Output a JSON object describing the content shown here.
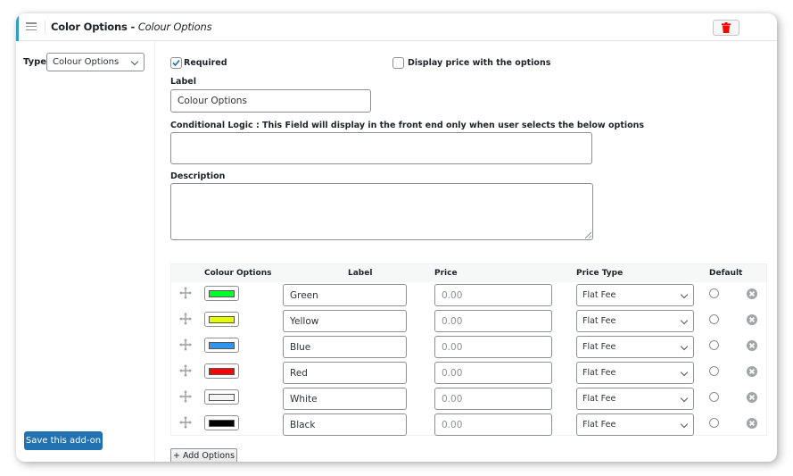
{
  "header": {
    "title_bold": "Color Options - ",
    "title_italic": "Colour Options",
    "menu_icon": "hamburger-menu-icon",
    "delete_icon": "trash-icon"
  },
  "sidebar": {
    "type_label": "Type",
    "type_value": "Colour Options",
    "save_button": "Save this add-on"
  },
  "form": {
    "required_label": "Required",
    "required_checked": true,
    "display_price_label": "Display price with the options",
    "display_price_checked": false,
    "label_heading": "Label",
    "label_value": "Colour Options",
    "conditional_logic_heading": "Conditional Logic : This Field will display in the front end only when user selects the below options",
    "conditional_logic_value": "",
    "description_heading": "Description",
    "description_value": ""
  },
  "options_table": {
    "headers": [
      "Colour Options",
      "Label",
      "Price",
      "Price Type",
      "Default"
    ],
    "rows": [
      {
        "color": "#00ff2a",
        "label": "Green",
        "price_placeholder": "0.00",
        "price_type": "Flat Fee",
        "default": false
      },
      {
        "color": "#e6ff00",
        "label": "Yellow",
        "price_placeholder": "0.00",
        "price_type": "Flat Fee",
        "default": false
      },
      {
        "color": "#2f95ee",
        "label": "Blue",
        "price_placeholder": "0.00",
        "price_type": "Flat Fee",
        "default": false
      },
      {
        "color": "#ff0000",
        "label": "Red",
        "price_placeholder": "0.00",
        "price_type": "Flat Fee",
        "default": false
      },
      {
        "color": "#f4f4f4",
        "label": "White",
        "price_placeholder": "0.00",
        "price_type": "Flat Fee",
        "default": false
      },
      {
        "color": "#000000",
        "label": "Black",
        "price_placeholder": "0.00",
        "price_type": "Flat Fee",
        "default": false
      }
    ],
    "add_button": "+ Add Options"
  },
  "colors": {
    "accent": "#2e9fbf",
    "primary_button": "#2271b1",
    "delete_icon": "#ff0000",
    "checkbox_check": "#2271b1"
  }
}
